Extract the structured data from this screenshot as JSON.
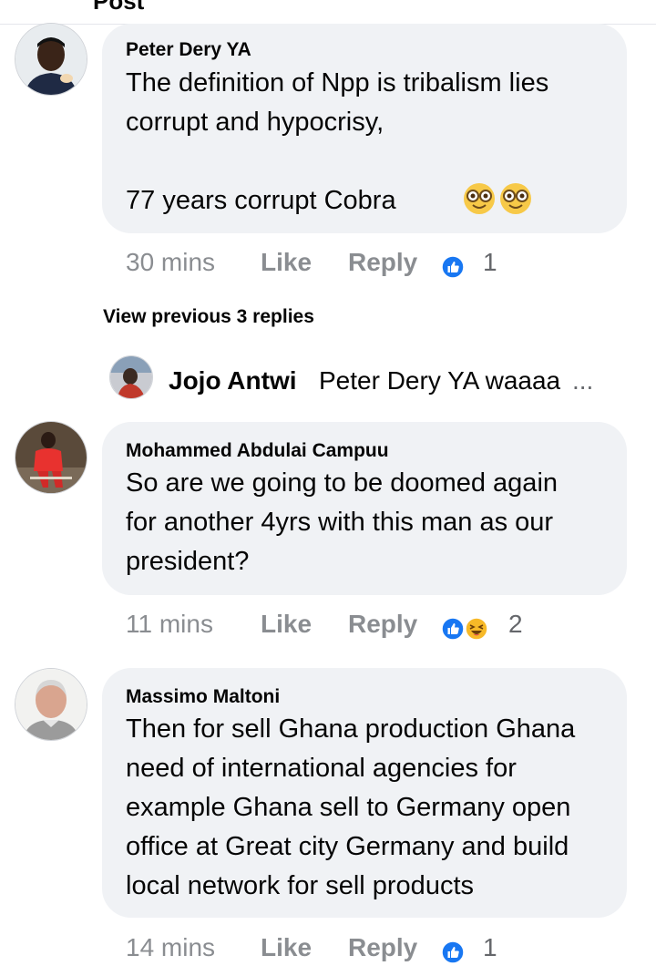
{
  "header": {
    "title": "Post"
  },
  "comments": [
    {
      "author": "Peter Dery YA",
      "text": "The definition of Npp is tribalism lies\ncorrupt and hypocrisy,\n\n    77 years corrupt Cobra",
      "time": "30 mins",
      "like_label": "Like",
      "reply_label": "Reply",
      "reactions": [
        "like-icon"
      ],
      "reaction_count": "1",
      "emoji": [
        "nerd-face-emoji",
        "nerd-face-emoji"
      ]
    },
    {
      "author": "Mohammed Abdulai Campuu",
      "text": "So are we going to be doomed again\nfor another 4yrs with this man as our\npresident?",
      "time": "11 mins",
      "like_label": "Like",
      "reply_label": "Reply",
      "reactions": [
        "like-icon",
        "haha-icon"
      ],
      "reaction_count": "2"
    },
    {
      "author": "Massimo Maltoni",
      "text": "Then for sell Ghana production Ghana\nneed of international agencies for\nexample Ghana sell to Germany open\noffice at Great city Germany and build\nlocal network for sell products",
      "time": "14 mins",
      "like_label": "Like",
      "reply_label": "Reply",
      "reactions": [
        "like-icon"
      ],
      "reaction_count": "1"
    }
  ],
  "replies_section": {
    "view_previous": "View previous 3 replies",
    "reply_author": "Jojo Antwi",
    "reply_text": "Peter Dery YA waaaa",
    "reply_ellipsis": "..."
  },
  "colors": {
    "bubble": "#f0f2f5",
    "meta_text": "#8a8d91",
    "like_blue": "#1877f2",
    "haha_yellow": "#f7b928"
  }
}
